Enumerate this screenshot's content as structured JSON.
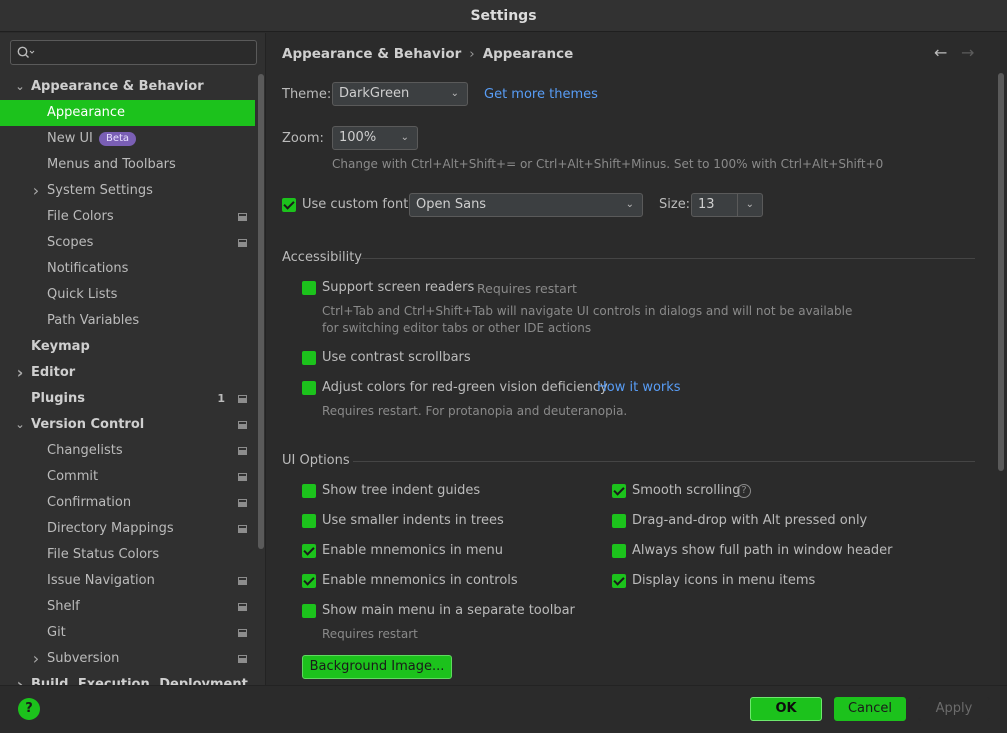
{
  "window": {
    "title": "Settings"
  },
  "search": {
    "placeholder": ""
  },
  "sidebar": {
    "items": [
      {
        "label": "Appearance & Behavior",
        "level": 0,
        "expanded": true
      },
      {
        "label": "Appearance",
        "level": 1,
        "selected": true
      },
      {
        "label": "New UI",
        "level": 1,
        "badge": "Beta"
      },
      {
        "label": "Menus and Toolbars",
        "level": 1
      },
      {
        "label": "System Settings",
        "level": 1,
        "collapsed": true
      },
      {
        "label": "File Colors",
        "level": 1,
        "project_icon": true
      },
      {
        "label": "Scopes",
        "level": 1,
        "project_icon": true
      },
      {
        "label": "Notifications",
        "level": 1
      },
      {
        "label": "Quick Lists",
        "level": 1
      },
      {
        "label": "Path Variables",
        "level": 1
      },
      {
        "label": "Keymap",
        "level": 0
      },
      {
        "label": "Editor",
        "level": 0,
        "collapsed": true
      },
      {
        "label": "Plugins",
        "level": 0,
        "count": "1",
        "project_icon": true
      },
      {
        "label": "Version Control",
        "level": 0,
        "expanded": true,
        "project_icon": true
      },
      {
        "label": "Changelists",
        "level": 1,
        "project_icon": true
      },
      {
        "label": "Commit",
        "level": 1,
        "project_icon": true
      },
      {
        "label": "Confirmation",
        "level": 1,
        "project_icon": true
      },
      {
        "label": "Directory Mappings",
        "level": 1,
        "project_icon": true
      },
      {
        "label": "File Status Colors",
        "level": 1
      },
      {
        "label": "Issue Navigation",
        "level": 1,
        "project_icon": true
      },
      {
        "label": "Shelf",
        "level": 1,
        "project_icon": true
      },
      {
        "label": "Git",
        "level": 1,
        "project_icon": true
      },
      {
        "label": "Subversion",
        "level": 1,
        "collapsed": true,
        "project_icon": true
      },
      {
        "label": "Build, Execution, Deployment",
        "level": 0,
        "collapsed": true
      }
    ]
  },
  "breadcrumb": {
    "parent": "Appearance & Behavior",
    "separator": "›",
    "current": "Appearance"
  },
  "nav": {
    "back": "←",
    "forward": "→"
  },
  "theme": {
    "label": "Theme:",
    "value": "DarkGreen",
    "link": "Get more themes"
  },
  "zoom": {
    "label": "Zoom:",
    "value": "100%",
    "hint": "Change with Ctrl+Alt+Shift+= or Ctrl+Alt+Shift+Minus. Set to 100% with Ctrl+Alt+Shift+0"
  },
  "font": {
    "checkbox_label": "Use custom font:",
    "checked": true,
    "value": "Open Sans",
    "size_label": "Size:",
    "size_value": "13"
  },
  "accessibility": {
    "title": "Accessibility",
    "screen_readers": {
      "label": "Support screen readers",
      "note": "Requires restart",
      "desc_line1": "Ctrl+Tab and Ctrl+Shift+Tab will navigate UI controls in dialogs and will not be available",
      "desc_line2": "for switching editor tabs or other IDE actions"
    },
    "contrast": {
      "label": "Use contrast scrollbars"
    },
    "color_deficiency": {
      "label": "Adjust colors for red-green vision deficiency",
      "link": "How it works",
      "desc": "Requires restart. For protanopia and deuteranopia."
    }
  },
  "ui_options": {
    "title": "UI Options",
    "left": [
      {
        "label": "Show tree indent guides",
        "checked": false
      },
      {
        "label": "Use smaller indents in trees",
        "checked": false
      },
      {
        "label": "Enable mnemonics in menu",
        "checked": true
      },
      {
        "label": "Enable mnemonics in controls",
        "checked": true
      },
      {
        "label": "Show main menu in a separate toolbar",
        "checked": false
      }
    ],
    "right": [
      {
        "label": "Smooth scrolling",
        "checked": true
      },
      {
        "label": "Drag-and-drop with Alt pressed only",
        "checked": false
      },
      {
        "label": "Always show full path in window header",
        "checked": false
      },
      {
        "label": "Display icons in menu items",
        "checked": true
      }
    ],
    "restart_note": "Requires restart",
    "background_button": "Background Image..."
  },
  "footer": {
    "help": "?",
    "ok": "OK",
    "cancel": "Cancel",
    "apply": "Apply"
  },
  "colors": {
    "accent": "#1cc21c",
    "background": "#2b2b2b",
    "link": "#589df6",
    "badge": "#7a5fb5"
  }
}
